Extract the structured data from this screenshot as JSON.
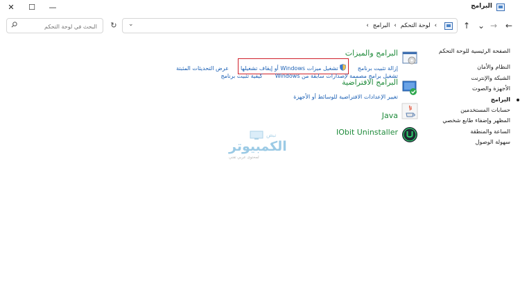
{
  "window": {
    "title": "البرامج",
    "controls": {
      "close": "✕",
      "maximize": "☐",
      "minimize": "—"
    }
  },
  "navigation": {
    "back_glyph": "←",
    "forward_glyph": "→",
    "recent_glyph": "⌄",
    "up_glyph": "↑",
    "refresh_glyph": "↻",
    "dropdown_glyph": "⌄",
    "address": {
      "root_separator": "›",
      "crumb1": "لوحة التحكم",
      "sep1": "›",
      "crumb2": "البرامج",
      "sep2": "›"
    },
    "search_placeholder": "البحث في لوحة التحكم"
  },
  "sidebar": {
    "home": "الصفحة الرئيسية للوحة التحكم",
    "items": [
      "النظام والأمان",
      "الشبكة والإنترنت",
      "الأجهزة والصوت",
      "البرامج",
      "حسابات المستخدمين",
      "المظهر وإضفاء طابع شخصي",
      "الساعة والمنطقة",
      "سهولة الوصول"
    ],
    "active_index": 3
  },
  "main": {
    "programs": {
      "title": "البرامج والميزات",
      "links": {
        "uninstall": "إزالة تثبيت برنامج",
        "windows_features": "تشغيل ميزات Windows أو إيقاف تشغيلها",
        "installed_updates": "عرض التحديثات المثبتة",
        "older_programs": "تشغيل برامج مصممة لإصدارات سابقة من Windows",
        "how_to_install": "كيفية تثبيت برنامج"
      }
    },
    "default_programs": {
      "title": "البرامج الافتراضية",
      "link": "تغيير الإعدادات الافتراضية للوسائط أو الأجهزة"
    },
    "java": {
      "title": "Java"
    },
    "iobit": {
      "title": "IObit Uninstaller"
    }
  },
  "watermark": {
    "line1": "نبض",
    "line2": "الكمبيوتر",
    "line3": "لمحتوى عربي تقني"
  },
  "colors": {
    "link": "#1a5fb4",
    "section_title": "#1e8a3a",
    "highlight_box": "#d0202a"
  }
}
